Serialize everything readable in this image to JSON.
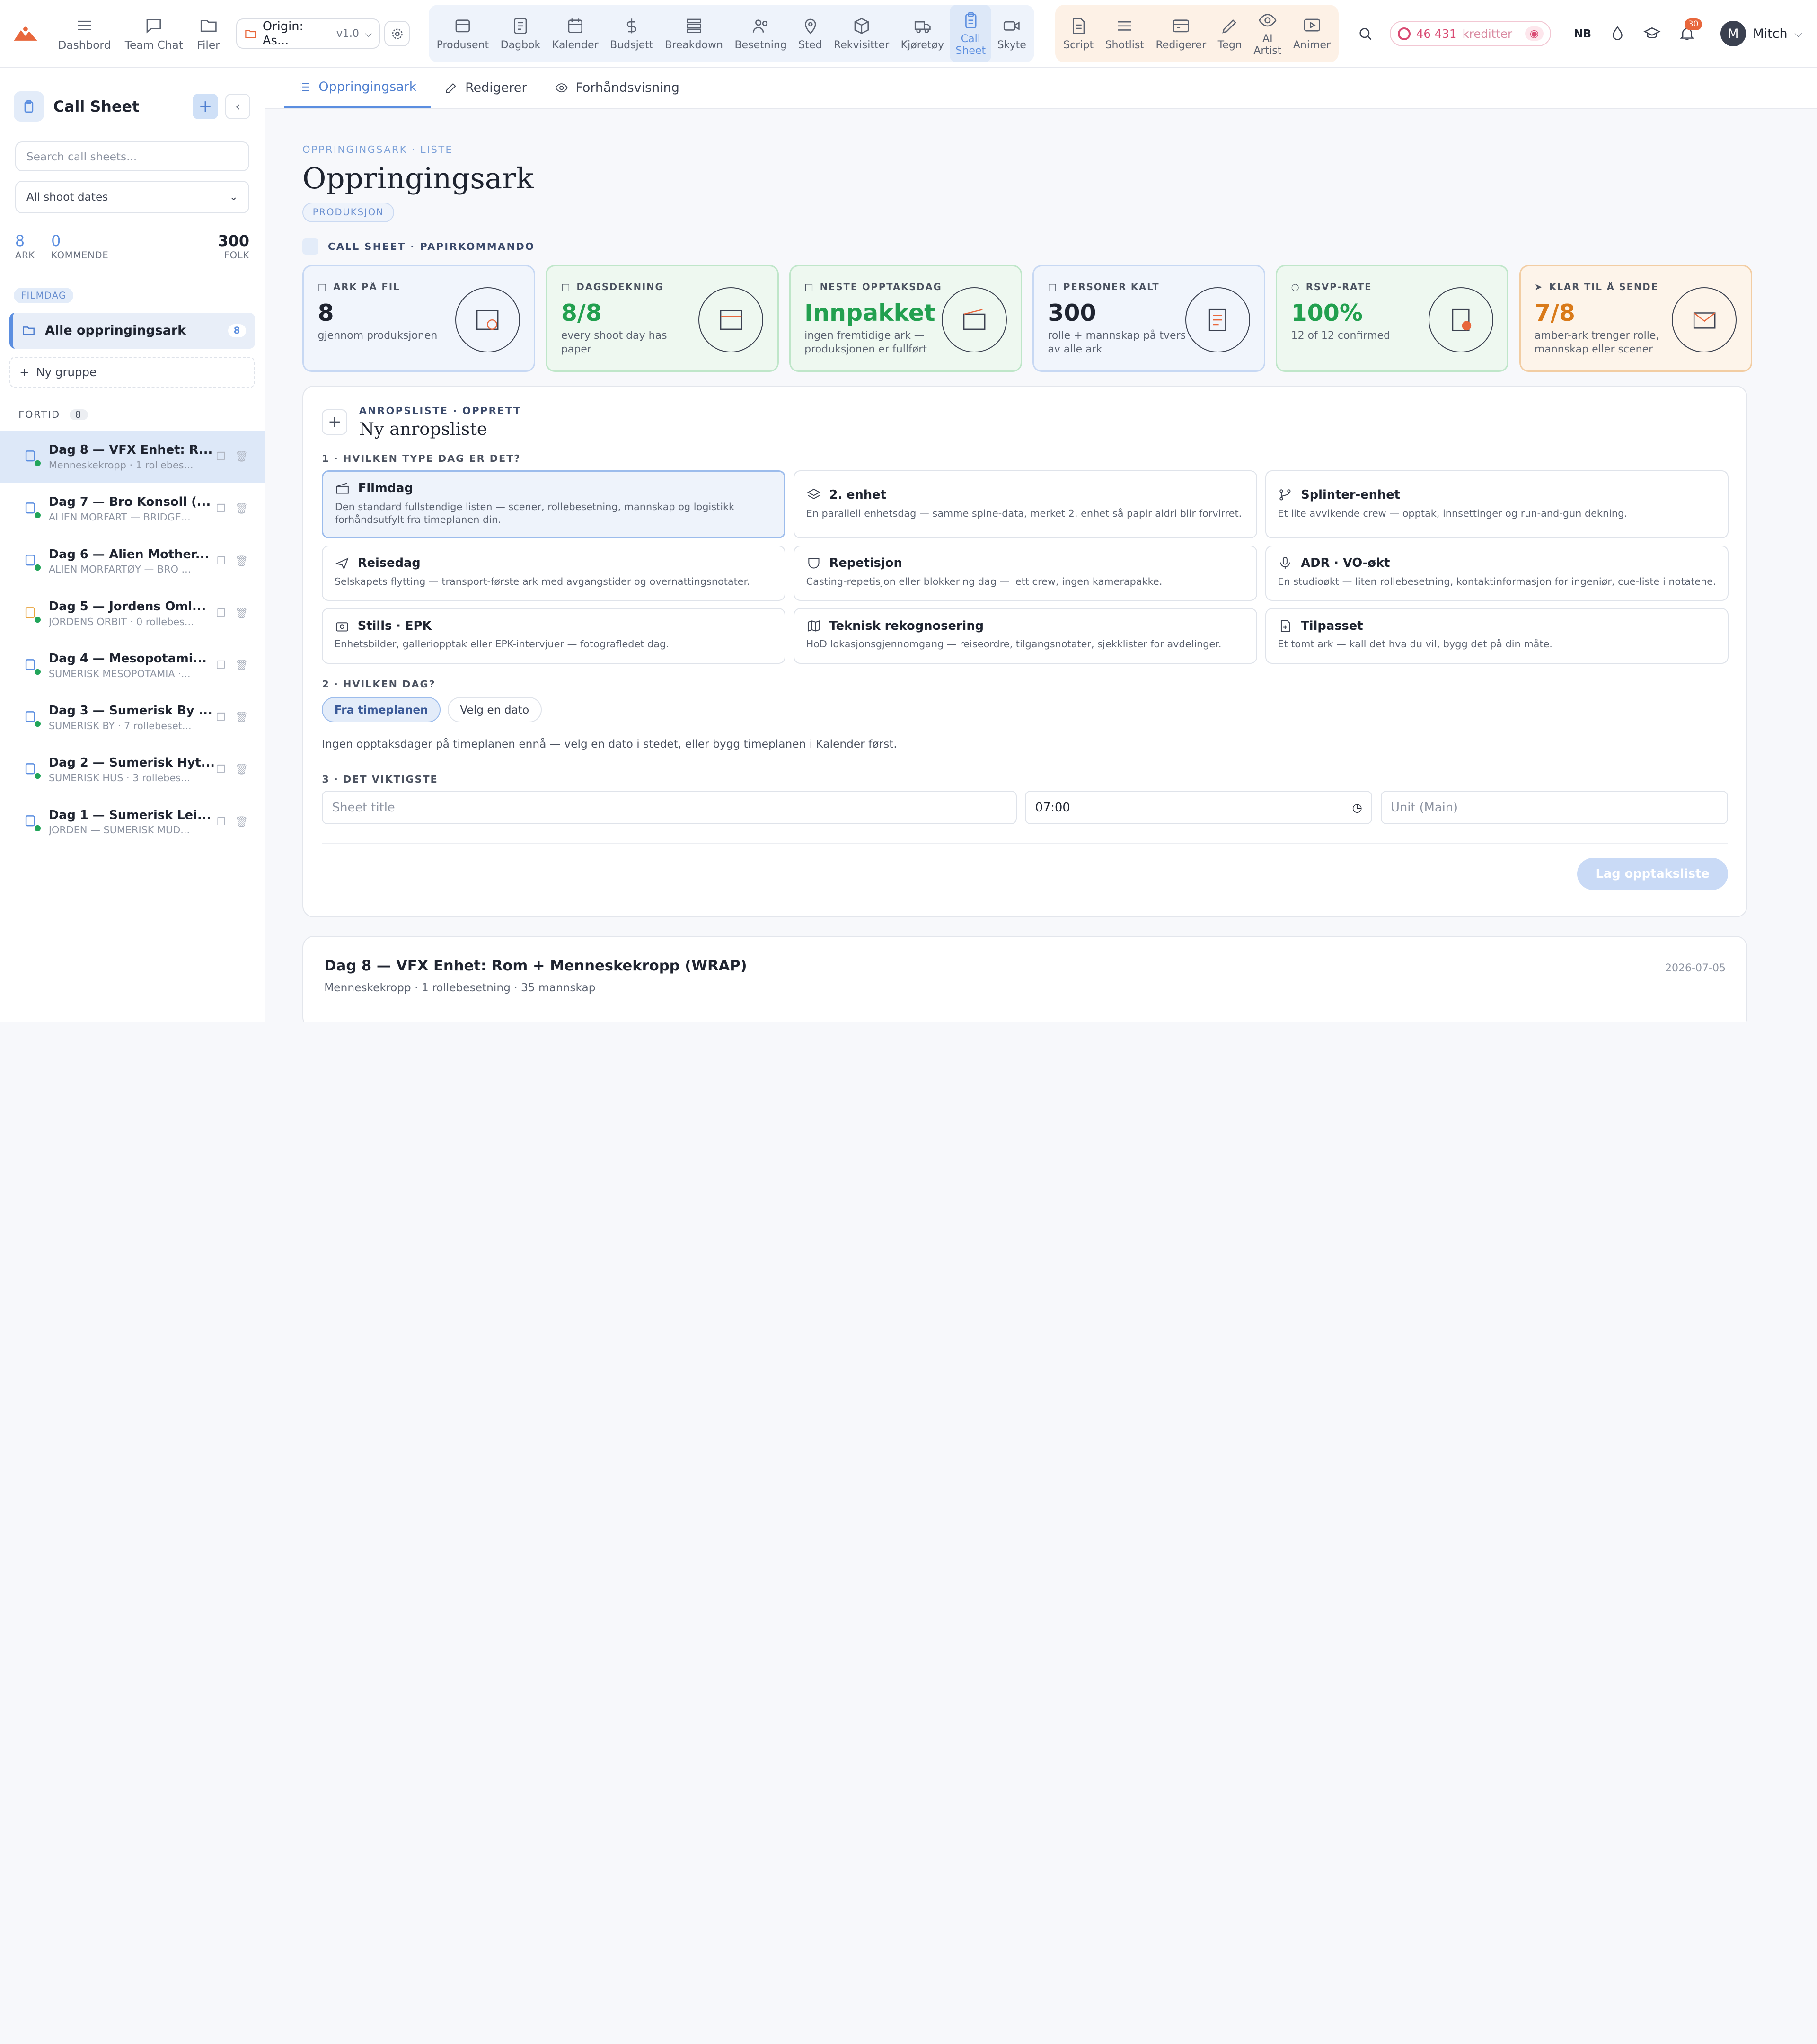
{
  "topbar": {
    "nav_left": [
      {
        "label": "Dashbord",
        "icon": "menu-icon"
      },
      {
        "label": "Team Chat",
        "icon": "chat-icon"
      },
      {
        "label": "Filer",
        "icon": "folder-icon"
      }
    ],
    "project": {
      "name": "Origin: As...",
      "version": "v1.0"
    },
    "group1": [
      {
        "label": "Produsent"
      },
      {
        "label": "Dagbok"
      },
      {
        "label": "Kalender"
      },
      {
        "label": "Budsjett"
      },
      {
        "label": "Breakdown"
      },
      {
        "label": "Besetning"
      },
      {
        "label": "Sted"
      },
      {
        "label": "Rekvisitter"
      },
      {
        "label": "Kjøretøy"
      },
      {
        "label": "Call\nSheet",
        "active": true
      },
      {
        "label": "Skyte"
      }
    ],
    "group2": [
      {
        "label": "Script"
      },
      {
        "label": "Shotlist"
      },
      {
        "label": "Redigerer"
      },
      {
        "label": "Tegn"
      },
      {
        "label": "AI\nArtist"
      },
      {
        "label": "Animer"
      }
    ],
    "credits": {
      "amount": "46 431",
      "label": "kreditter"
    },
    "lang": "NB",
    "notifications": "30",
    "user": {
      "initial": "M",
      "name": "Mitch"
    }
  },
  "sidebar": {
    "title": "Call Sheet",
    "search_placeholder": "Search call sheets...",
    "filter": "All shoot dates",
    "stats": [
      {
        "n": "8",
        "l": "ARK"
      },
      {
        "n": "0",
        "l": "KOMMENDE"
      }
    ],
    "stat_right": {
      "n": "300",
      "l": "FOLK"
    },
    "group_pill": "FILMDAG",
    "all": {
      "label": "Alle oppringingsark",
      "count": "8"
    },
    "new_group": "Ny gruppe",
    "section": {
      "label": "FORTID",
      "count": "8"
    },
    "items": [
      {
        "t1": "Dag 8 — VFX Enhet: R...",
        "t2": "Menneskekropp · 1 rollebes..."
      },
      {
        "t1": "Dag 7 — Bro Konsoll (...",
        "t2": "ALIEN MORFART — BRIDGE..."
      },
      {
        "t1": "Dag 6 — Alien Mother...",
        "t2": "ALIEN MORFARTØY — BRO ..."
      },
      {
        "t1": "Dag 5 — Jordens Oml...",
        "t2": "JORDENS ORBIT · 0 rollebes..."
      },
      {
        "t1": "Dag 4 — Mesopotami...",
        "t2": "SUMERISK MESOPOTAMIA ·..."
      },
      {
        "t1": "Dag 3 — Sumerisk By ...",
        "t2": "SUMERISK BY · 7 rollebeset..."
      },
      {
        "t1": "Dag 2 — Sumerisk Hyt...",
        "t2": "SUMERISK HUS · 3 rollebes..."
      },
      {
        "t1": "Dag 1 — Sumerisk Lei...",
        "t2": "JORDEN — SUMERISK MUD..."
      }
    ]
  },
  "tabs": [
    {
      "label": "Oppringingsark",
      "active": true
    },
    {
      "label": "Redigerer"
    },
    {
      "label": "Forhåndsvisning"
    }
  ],
  "main": {
    "crumb": "OPPRINGINGSARK · LISTE",
    "title": "Oppringingsark",
    "badge": "PRODUKSJON",
    "section_label": "CALL SHEET · PAPIRKOMMANDO",
    "cards": [
      {
        "k": "ARK PÅ FIL",
        "v": "8",
        "s": "gjennom produksjonen",
        "theme": "blue",
        "vc": "dark"
      },
      {
        "k": "DAGSDEKNING",
        "v": "8/8",
        "s": "every shoot day has paper",
        "theme": "green",
        "vc": "green"
      },
      {
        "k": "NESTE OPPTAKSDAG",
        "v": "Innpakket",
        "s": "ingen fremtidige ark — produksjonen er fullført",
        "theme": "green",
        "vc": "green"
      },
      {
        "k": "PERSONER KALT",
        "v": "300",
        "s": "rolle + mannskap på tvers av alle ark",
        "theme": "blue",
        "vc": "dark"
      },
      {
        "k": "RSVP-RATE",
        "v": "100%",
        "s": "12 of 12 confirmed",
        "theme": "green",
        "vc": "green"
      },
      {
        "k": "KLAR TIL Å SENDE",
        "v": "7/8",
        "s": "amber-ark trenger rolle, mannskap eller scener",
        "theme": "orange",
        "vc": "orange"
      }
    ],
    "panel": {
      "kicker": "ANROPSLISTE · OPPRETT",
      "title": "Ny anropsliste",
      "q1": "1 · HVILKEN TYPE DAG ER DET?",
      "options": [
        {
          "n": "Filmdag",
          "d": "Den standard fullstendige listen — scener, rollebesetning, mannskap og logistikk forhåndsutfylt fra timeplanen din."
        },
        {
          "n": "2. enhet",
          "d": "En parallell enhetsdag — samme spine-data, merket 2. enhet så papir aldri blir forvirret."
        },
        {
          "n": "Splinter-enhet",
          "d": "Et lite avvikende crew — opptak, innsettinger og run-and-gun dekning."
        },
        {
          "n": "Reisedag",
          "d": "Selskapets flytting — transport-første ark med avgangstider og overnattingsnotater."
        },
        {
          "n": "Repetisjon",
          "d": "Casting-repetisjon eller blokkering dag — lett crew, ingen kamerapakke."
        },
        {
          "n": "ADR · VO-økt",
          "d": "En studioøkt — liten rollebesetning, kontaktinformasjon for ingeniør, cue-liste i notatene."
        },
        {
          "n": "Stills · EPK",
          "d": "Enhetsbilder, galleriopptak eller EPK-intervjuer — fotografledet dag."
        },
        {
          "n": "Teknisk rekognosering",
          "d": "HoD lokasjonsgjennomgang — reiseordre, tilgangsnotater, sjekklister for avdelinger."
        },
        {
          "n": "Tilpasset",
          "d": "Et tomt ark — kall det hva du vil, bygg det på din måte."
        }
      ],
      "q2": "2 · HVILKEN DAG?",
      "chip1": "Fra timeplanen",
      "chip2": "Velg en dato",
      "note": "Ingen opptaksdager på timeplanen ennå — velg en dato i stedet, eller bygg timeplanen i Kalender først.",
      "q3": "3 · DET VIKTIGSTE",
      "sheet_title_placeholder": "Sheet title",
      "time": "07:00",
      "unit_placeholder": "Unit (Main)",
      "submit": "Lag opptaksliste"
    },
    "entry": {
      "title": "Dag 8 — VFX Enhet: Rom + Menneskekropp (WRAP)",
      "sub": "Menneskekropp · 1 rollebesetning · 35 mannskap",
      "date": "2026-07-05"
    }
  }
}
